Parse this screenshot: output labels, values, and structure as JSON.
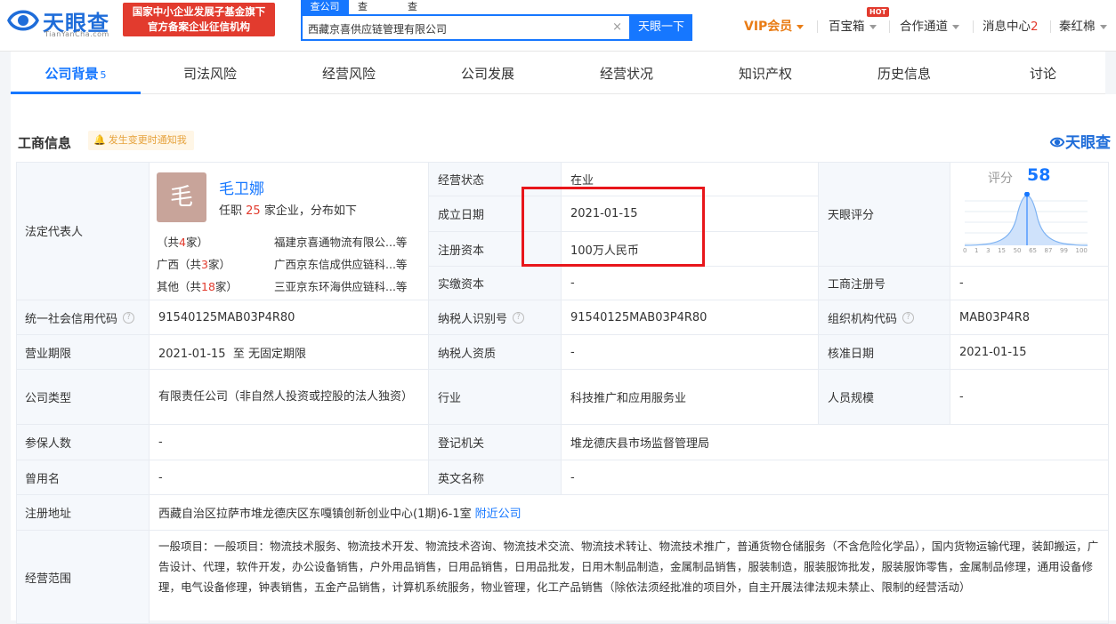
{
  "header": {
    "logo_cn": "天眼查",
    "logo_en": "TianYanCha.com",
    "slogan_line1": "国家中小企业发展子基金旗下",
    "slogan_line2": "官方备案企业征信机构",
    "search_tabs": [
      "查公司",
      "查老板",
      "查关系"
    ],
    "search_value": "西藏京喜供应链管理有限公司",
    "search_clear": "×",
    "search_button": "天眼一下",
    "vip": "VIP会员",
    "treasure": "百宝箱",
    "hot_badge": "HOT",
    "cooperate": "合作通道",
    "messages": "消息中心",
    "message_count": "2",
    "user": "秦红棉"
  },
  "tabs": [
    {
      "label": "公司背景",
      "count": "5"
    },
    {
      "label": "司法风险"
    },
    {
      "label": "经营风险"
    },
    {
      "label": "公司发展"
    },
    {
      "label": "经营状况"
    },
    {
      "label": "知识产权"
    },
    {
      "label": "历史信息"
    },
    {
      "label": "讨论"
    }
  ],
  "section": {
    "title": "工商信息",
    "notify": "发生变更时通知我",
    "brand": "天眼查"
  },
  "info": {
    "legal_rep_label": "法定代表人",
    "avatar_char": "毛",
    "rep_name": "毛卫娜",
    "rep_sub_prefix": "任职",
    "rep_sub_count": "25",
    "rep_sub_suffix": "家企业，分布如下",
    "distribution": [
      {
        "region_prefix": "（共",
        "count": "4",
        "region_suffix": "家）",
        "company": "福建京喜通物流有限公...等"
      },
      {
        "region_prefix": "广西（共",
        "count": "3",
        "region_suffix": "家）",
        "company": "广西京东信成供应链科...等"
      },
      {
        "region_prefix": "其他（共",
        "count": "18",
        "region_suffix": "家）",
        "company": "三亚京东环海供应链科...等"
      }
    ],
    "status_label": "经营状态",
    "status": "在业",
    "found_label": "成立日期",
    "found": "2021-01-15",
    "capital_label": "注册资本",
    "capital": "100万人民币",
    "paid_label": "实缴资本",
    "paid": "-",
    "score_label": "天眼评分",
    "score_word": "评分",
    "score": "58",
    "score_ticks": [
      "0",
      "1",
      "3",
      "15",
      "50",
      "65",
      "87",
      "99",
      "100"
    ],
    "reg_no_label": "工商注册号",
    "reg_no": "-",
    "credit_label": "统一社会信用代码",
    "credit": "91540125MAB03P4R80",
    "taxid_label": "纳税人识别号",
    "taxid": "91540125MAB03P4R80",
    "org_label": "组织机构代码",
    "org": "MAB03P4R8",
    "term_label": "营业期限",
    "term": "2021-01-15  至 无固定期限",
    "taxq_label": "纳税人资质",
    "taxq": "-",
    "approve_label": "核准日期",
    "approve": "2021-01-15",
    "type_label": "公司类型",
    "type": "有限责任公司（非自然人投资或控股的法人独资）",
    "industry_label": "行业",
    "industry": "科技推广和应用服务业",
    "staff_label": "人员规模",
    "staff": "-",
    "insured_label": "参保人数",
    "insured": "-",
    "authority_label": "登记机关",
    "authority": "堆龙德庆县市场监督管理局",
    "former_label": "曾用名",
    "former": "-",
    "english_label": "英文名称",
    "english": "-",
    "address_label": "注册地址",
    "address": "西藏自治区拉萨市堆龙德庆区东嘎镇创新创业中心(1期)6-1室",
    "address_link": "附近公司",
    "scope_label": "经营范围",
    "scope": "一般项目：一般项目：物流技术服务、物流技术开发、物流技术咨询、物流技术交流、物流技术转让、物流技术推广，普通货物仓储服务（不含危险化学品），国内货物运输代理，装卸搬运，广告设计、代理，软件开发，办公设备销售，户外用品销售，日用品销售，日用品批发，日用木制品制造，金属制品销售，服装制造，服装服饰批发，服装服饰零售，金属制品修理，通用设备修理，电气设备修理，钟表销售，五金产品销售，计算机系统服务，物业管理，化工产品销售（除依法须经批准的项目外，自主开展法律法规未禁止、限制的经营活动）"
  },
  "colors": {
    "accent": "#1677ff",
    "highlight": "#e8161b",
    "brand_red": "#e23b2e"
  }
}
